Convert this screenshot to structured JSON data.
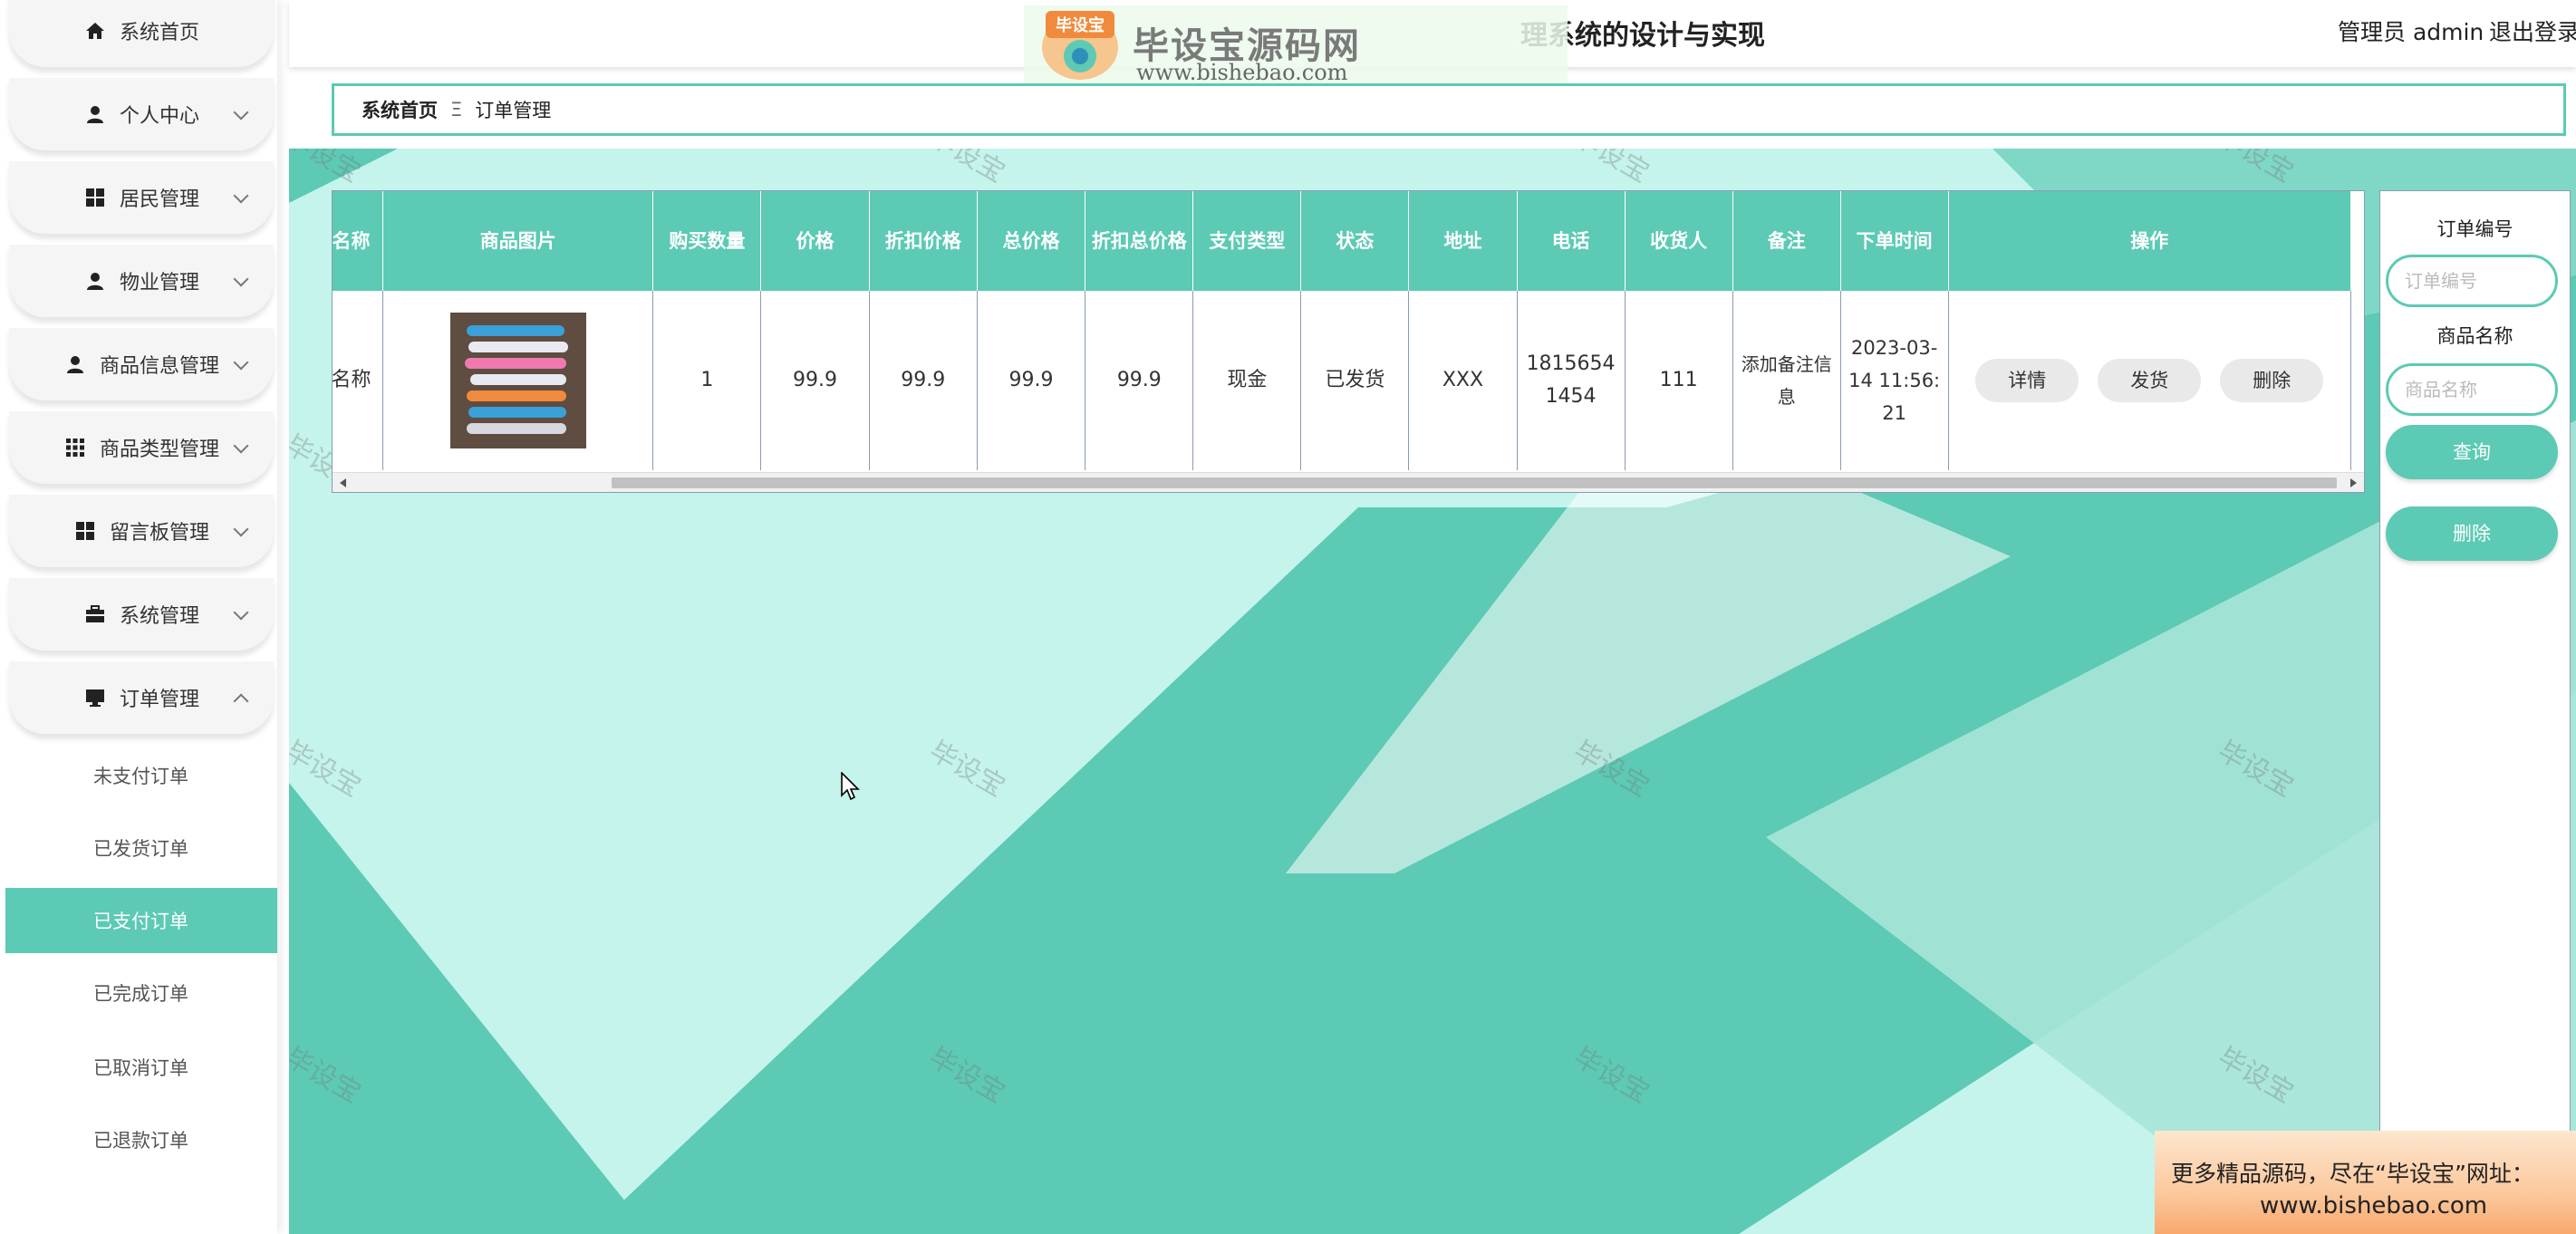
{
  "header": {
    "title": "理系统的设计与实现",
    "user": "管理员 admin",
    "logout": "退出登录"
  },
  "logo": {
    "badge": "毕设宝",
    "name": "毕设宝源码网",
    "url": "www.bishebao.com"
  },
  "watermark": {
    "text": "毕设宝"
  },
  "sidebar": {
    "items": [
      {
        "label": "系统首页",
        "icon": "home-icon"
      },
      {
        "label": "个人中心",
        "icon": "user-icon"
      },
      {
        "label": "居民管理",
        "icon": "grid-icon"
      },
      {
        "label": "物业管理",
        "icon": "user-icon"
      },
      {
        "label": "商品信息管理",
        "icon": "user-icon"
      },
      {
        "label": "商品类型管理",
        "icon": "apps-icon"
      },
      {
        "label": "留言板管理",
        "icon": "grid-icon"
      },
      {
        "label": "系统管理",
        "icon": "briefcase-icon"
      },
      {
        "label": "订单管理",
        "icon": "monitor-icon"
      }
    ],
    "sub_items": [
      {
        "label": "未支付订单"
      },
      {
        "label": "已发货订单"
      },
      {
        "label": "已支付订单",
        "active": true
      },
      {
        "label": "已完成订单"
      },
      {
        "label": "已取消订单"
      },
      {
        "label": "已退款订单"
      }
    ]
  },
  "breadcrumb": {
    "home": "系统首页",
    "separator": "Ξ",
    "current": "订单管理"
  },
  "table": {
    "columns": [
      "名称",
      "商品图片",
      "购买数量",
      "价格",
      "折扣价格",
      "总价格",
      "折扣总价格",
      "支付类型",
      "状态",
      "地址",
      "电话",
      "收货人",
      "备注",
      "下单时间",
      "操作"
    ],
    "rows": [
      {
        "name": "名称",
        "quantity": "1",
        "price": "99.9",
        "discount_price": "99.9",
        "total": "99.9",
        "discount_total": "99.9",
        "pay_type": "现金",
        "status": "已发货",
        "address": "XXX",
        "phone": "18156541454",
        "receiver": "111",
        "remark": "添加备注信息",
        "time": "2023-03-14 11:56:21"
      }
    ],
    "actions": {
      "detail": "详情",
      "ship": "发货",
      "delete": "删除"
    }
  },
  "search": {
    "order_no_label": "订单编号",
    "order_no_placeholder": "订单编号",
    "product_name_label": "商品名称",
    "product_name_placeholder": "商品名称",
    "query_button": "查询",
    "delete_button": "删除"
  },
  "ad": {
    "line1": "更多精品源码，尽在“毕设宝”网址：",
    "line2": "www.bishebao.com"
  },
  "colors": {
    "accent": "#5ccab4",
    "background": "#c4f4ec"
  }
}
